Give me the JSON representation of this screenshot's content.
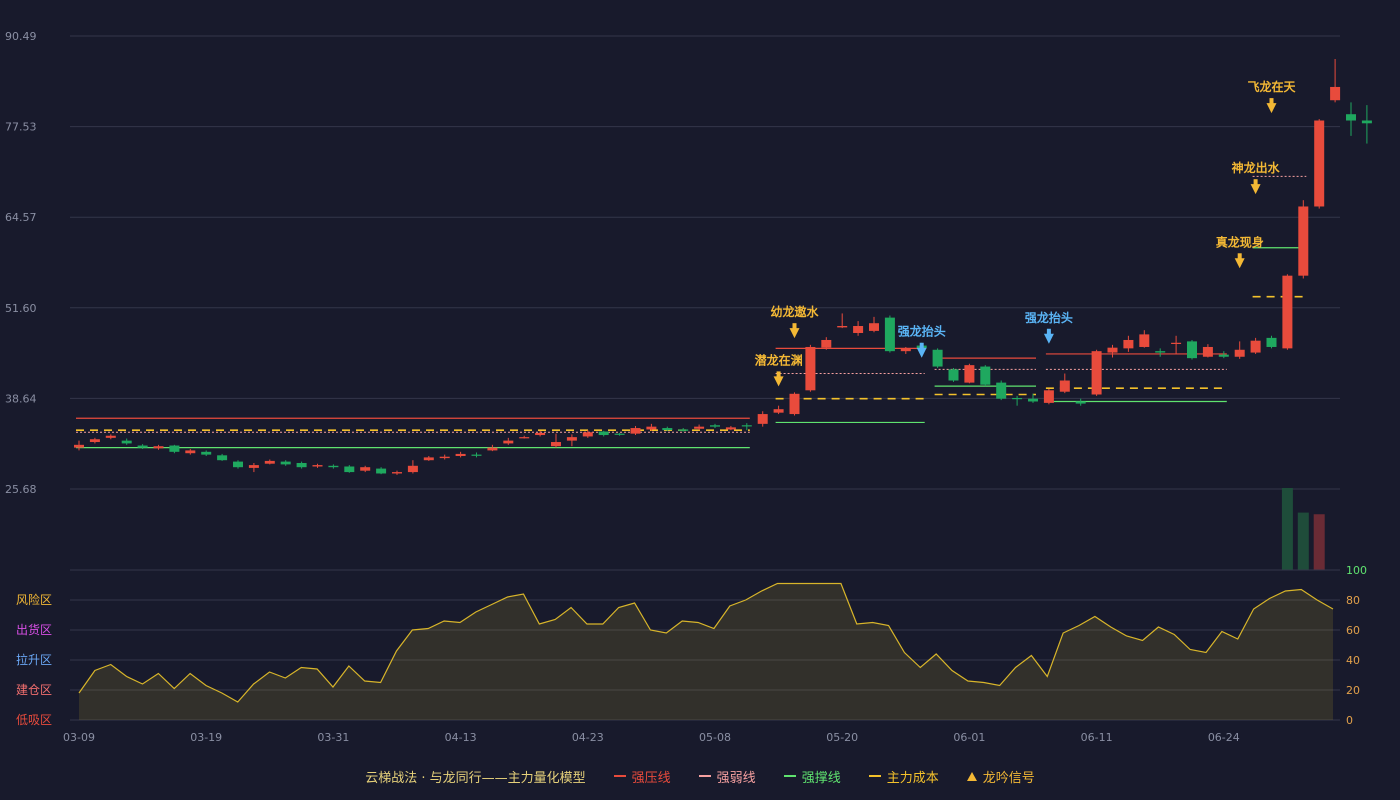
{
  "chart_data": {
    "type": "candlestick",
    "title": "云梯战法 · 与龙同行——主力量化模型",
    "price_axis": {
      "ticks": [
        "90.49",
        "77.53",
        "64.57",
        "51.60",
        "38.64",
        "25.68"
      ],
      "min": 25.68,
      "max": 90.49
    },
    "date_ticks": [
      "03-09",
      "03-19",
      "03-31",
      "04-13",
      "04-23",
      "05-08",
      "05-20",
      "06-01",
      "06-11",
      "06-24"
    ],
    "date_tick_index": [
      0,
      8,
      16,
      24,
      32,
      40,
      48,
      56,
      64,
      72
    ],
    "candles": [
      [
        31.6,
        32.0,
        31.2,
        32.6
      ],
      [
        32.4,
        32.8,
        32.2,
        33.0
      ],
      [
        33.0,
        33.3,
        32.8,
        33.5
      ],
      [
        32.6,
        32.2,
        32.0,
        32.9
      ],
      [
        31.9,
        31.6,
        31.4,
        32.1
      ],
      [
        31.5,
        31.8,
        31.3,
        32.0
      ],
      [
        31.9,
        31.0,
        30.8,
        32.0
      ],
      [
        30.8,
        31.2,
        30.6,
        31.4
      ],
      [
        31.0,
        30.6,
        30.4,
        31.2
      ],
      [
        30.5,
        29.8,
        29.7,
        30.7
      ],
      [
        29.6,
        28.8,
        28.6,
        29.8
      ],
      [
        28.7,
        29.1,
        28.1,
        29.4
      ],
      [
        29.3,
        29.7,
        29.2,
        29.9
      ],
      [
        29.6,
        29.2,
        29.0,
        29.8
      ],
      [
        29.4,
        28.8,
        28.6,
        29.6
      ],
      [
        28.9,
        29.1,
        28.7,
        29.3
      ],
      [
        29.0,
        28.8,
        28.6,
        29.2
      ],
      [
        28.9,
        28.1,
        28.0,
        29.1
      ],
      [
        28.3,
        28.8,
        28.1,
        29.0
      ],
      [
        28.6,
        27.9,
        27.8,
        28.8
      ],
      [
        27.9,
        28.1,
        27.7,
        28.3
      ],
      [
        28.1,
        29.0,
        27.9,
        29.8
      ],
      [
        29.8,
        30.2,
        29.7,
        30.4
      ],
      [
        30.1,
        30.3,
        29.9,
        30.6
      ],
      [
        30.4,
        30.7,
        30.2,
        31.0
      ],
      [
        30.6,
        30.5,
        30.2,
        30.9
      ],
      [
        31.2,
        31.6,
        31.1,
        32.0
      ],
      [
        32.2,
        32.6,
        32.0,
        33.0
      ],
      [
        33.0,
        33.1,
        32.9,
        33.3
      ],
      [
        33.4,
        33.7,
        33.2,
        34.0
      ],
      [
        31.8,
        32.4,
        31.6,
        33.6
      ],
      [
        32.6,
        33.1,
        31.8,
        33.5
      ],
      [
        33.2,
        33.8,
        33.0,
        34.1
      ],
      [
        33.9,
        33.4,
        33.2,
        34.0
      ],
      [
        33.6,
        33.5,
        33.3,
        33.7
      ],
      [
        33.6,
        34.4,
        33.4,
        34.7
      ],
      [
        34.2,
        34.6,
        34.0,
        35.0
      ],
      [
        34.4,
        34.1,
        34.0,
        34.6
      ],
      [
        34.2,
        34.0,
        33.9,
        34.4
      ],
      [
        34.3,
        34.6,
        34.1,
        34.9
      ],
      [
        34.8,
        34.6,
        34.4,
        35.0
      ],
      [
        34.2,
        34.5,
        34.1,
        34.7
      ],
      [
        34.8,
        34.7,
        34.1,
        35.1
      ],
      [
        35.0,
        36.4,
        34.6,
        36.8
      ],
      [
        36.6,
        37.1,
        36.4,
        37.6
      ],
      [
        36.4,
        39.3,
        36.2,
        39.5
      ],
      [
        39.8,
        46.0,
        39.6,
        46.3
      ],
      [
        45.9,
        47.0,
        45.6,
        47.4
      ],
      [
        48.8,
        49.0,
        48.7,
        50.8
      ],
      [
        48.0,
        49.0,
        47.6,
        49.7
      ],
      [
        48.3,
        49.4,
        48.1,
        50.3
      ],
      [
        50.2,
        45.4,
        45.2,
        50.5
      ],
      [
        45.4,
        45.8,
        45.0,
        46.0
      ],
      [
        46.2,
        45.8,
        44.6,
        46.6
      ],
      [
        45.6,
        43.2,
        43.0,
        45.8
      ],
      [
        42.8,
        41.2,
        41.0,
        43.0
      ],
      [
        40.9,
        43.4,
        40.8,
        43.6
      ],
      [
        43.2,
        40.6,
        40.4,
        43.4
      ],
      [
        40.9,
        38.6,
        38.4,
        41.2
      ],
      [
        38.7,
        38.6,
        37.6,
        39.0
      ],
      [
        38.6,
        38.2,
        38.0,
        39.3
      ],
      [
        38.0,
        39.8,
        37.8,
        40.0
      ],
      [
        39.6,
        41.2,
        39.4,
        42.2
      ],
      [
        38.2,
        37.9,
        37.6,
        38.6
      ],
      [
        39.2,
        45.4,
        39.0,
        45.6
      ],
      [
        45.2,
        45.9,
        44.5,
        46.3
      ],
      [
        45.8,
        47.0,
        45.3,
        47.6
      ],
      [
        46.0,
        47.8,
        45.9,
        48.4
      ],
      [
        45.4,
        45.2,
        44.6,
        45.8
      ],
      [
        46.5,
        46.6,
        45.0,
        47.6
      ],
      [
        46.8,
        44.4,
        44.2,
        47.0
      ],
      [
        44.6,
        46.0,
        44.5,
        46.4
      ],
      [
        44.9,
        44.6,
        44.4,
        45.4
      ],
      [
        44.6,
        45.6,
        44.3,
        46.8
      ],
      [
        45.2,
        46.9,
        45.0,
        47.3
      ],
      [
        47.3,
        46.0,
        45.8,
        47.6
      ],
      [
        45.8,
        56.2,
        45.6,
        56.4
      ],
      [
        56.2,
        66.1,
        55.8,
        67.0
      ],
      [
        66.1,
        78.4,
        65.8,
        78.6
      ],
      [
        81.3,
        83.2,
        81.0,
        87.2
      ],
      [
        79.3,
        78.4,
        76.2,
        81.0
      ],
      [
        78.4,
        78.0,
        75.1,
        80.6
      ]
    ],
    "lines": [
      {
        "name": "强压线",
        "start": 0,
        "end": 42,
        "value": 35.8
      },
      {
        "name": "强弱线",
        "start": 0,
        "end": 42,
        "value": 33.8
      },
      {
        "name": "强撑线",
        "start": 0,
        "end": 42,
        "value": 31.6
      },
      {
        "name": "主力成本",
        "start": 0,
        "end": 42,
        "value": 34.1
      },
      {
        "name": "强压线",
        "start": 44,
        "end": 53,
        "value": 45.8
      },
      {
        "name": "强弱线",
        "start": 44,
        "end": 53,
        "value": 42.2
      },
      {
        "name": "强撑线",
        "start": 44,
        "end": 53,
        "value": 35.2
      },
      {
        "name": "主力成本",
        "start": 44,
        "end": 53,
        "value": 38.6
      },
      {
        "name": "强压线",
        "start": 54,
        "end": 60,
        "value": 44.4
      },
      {
        "name": "强弱线",
        "start": 54,
        "end": 60,
        "value": 42.8
      },
      {
        "name": "强撑线",
        "start": 54,
        "end": 60,
        "value": 40.4
      },
      {
        "name": "主力成本",
        "start": 54,
        "end": 60,
        "value": 39.2
      },
      {
        "name": "强压线",
        "start": 61,
        "end": 72,
        "value": 45.0
      },
      {
        "name": "强弱线",
        "start": 61,
        "end": 72,
        "value": 42.8
      },
      {
        "name": "强撑线",
        "start": 61,
        "end": 72,
        "value": 38.2
      },
      {
        "name": "主力成本",
        "start": 61,
        "end": 72,
        "value": 40.1
      },
      {
        "name": "强弱线",
        "start": 74,
        "end": 77,
        "value": 70.4
      },
      {
        "name": "强撑线",
        "start": 74,
        "end": 77,
        "value": 60.2
      },
      {
        "name": "主力成本",
        "start": 74,
        "end": 77,
        "value": 53.2
      }
    ],
    "signals": [
      {
        "label": "潜龙在渊",
        "index": 44,
        "value": 39.5,
        "color": "#f3b835"
      },
      {
        "label": "幼龙遨水",
        "index": 45,
        "value": 46.4,
        "color": "#f3b835"
      },
      {
        "label": "强龙抬头",
        "index": 53,
        "value": 43.6,
        "color": "#5ab4f5"
      },
      {
        "label": "强龙抬头",
        "index": 61,
        "value": 45.6,
        "color": "#5ab4f5"
      },
      {
        "label": "真龙现身",
        "index": 73,
        "value": 56.4,
        "color": "#f3b835"
      },
      {
        "label": "神龙出水",
        "index": 74,
        "value": 67.0,
        "color": "#f3b835"
      },
      {
        "label": "飞龙在天",
        "index": 75,
        "value": 78.6,
        "color": "#f3b835"
      }
    ],
    "volume_bars": [
      {
        "index": 76,
        "level": 1.0,
        "color": "#1e4d3a"
      },
      {
        "index": 77,
        "level": 0.7,
        "color": "#1f4c3a"
      },
      {
        "index": 78,
        "level": 0.68,
        "color": "#6a2b35"
      }
    ],
    "indicator": {
      "ticks": [
        "100",
        "80",
        "60",
        "40",
        "20",
        "0"
      ],
      "zones": [
        "风险区",
        "出货区",
        "拉升区",
        "建仓区",
        "低吸区"
      ],
      "values": [
        18,
        33,
        37,
        29,
        24,
        31,
        21,
        31,
        23,
        18,
        12,
        24,
        32,
        28,
        35,
        34,
        22,
        36,
        26,
        25,
        46,
        60,
        61,
        66,
        65,
        72,
        77,
        82,
        84,
        64,
        67,
        75,
        64,
        64,
        75,
        78,
        60,
        58,
        66,
        65,
        61,
        76,
        80,
        86,
        91,
        91,
        91,
        91,
        91,
        64,
        65,
        63,
        45,
        35,
        44,
        33,
        26,
        25,
        23,
        35,
        43,
        29,
        58,
        63,
        69,
        62,
        56,
        53,
        62,
        57,
        47,
        45,
        59,
        54,
        74,
        81,
        86,
        87,
        80,
        74
      ]
    }
  },
  "legend": {
    "title": "云梯战法 · 与龙同行——主力量化模型",
    "items": [
      {
        "label": "强压线",
        "color": "#e84b3c"
      },
      {
        "label": "强弱线",
        "color": "#f6a0a0"
      },
      {
        "label": "强撑线",
        "color": "#5fe36f"
      },
      {
        "label": "主力成本",
        "color": "#f3c12b"
      },
      {
        "label": "龙吟信号",
        "color": "#f3b835"
      }
    ]
  },
  "colors": {
    "up": "#e84b3c",
    "down": "#1fa85f",
    "background": "#181a2c",
    "grid": "#33364a",
    "axis_text": "#8a8fa3",
    "indicator_line": "#d8b52a"
  }
}
